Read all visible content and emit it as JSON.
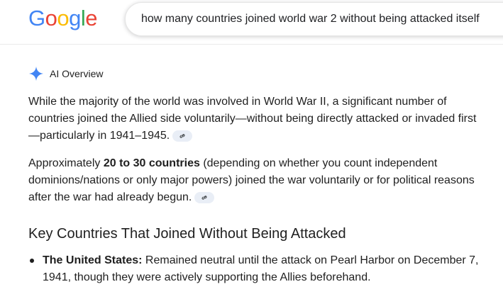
{
  "header": {
    "logo_text": "Google",
    "logo_letters": [
      {
        "ch": "G",
        "color": "#4285F4"
      },
      {
        "ch": "o",
        "color": "#EA4335"
      },
      {
        "ch": "o",
        "color": "#FBBC05"
      },
      {
        "ch": "g",
        "color": "#4285F4"
      },
      {
        "ch": "l",
        "color": "#34A853"
      },
      {
        "ch": "e",
        "color": "#EA4335"
      }
    ],
    "search_query": "how many countries joined world war 2 without being attacked itself"
  },
  "ai_overview": {
    "title": "AI Overview",
    "paragraph_1": "While the majority of the world was involved in World War II, a significant number of countries joined the Allied side voluntarily—without being directly attacked or invaded first—particularly in 1941–1945.",
    "paragraph_2_prefix": "Approximately ",
    "paragraph_2_bold": "20 to 30 countries",
    "paragraph_2_suffix": " (depending on whether you count independent dominions/nations or only major powers) joined the war voluntarily or for political reasons after the war had already begun.",
    "section_heading": "Key Countries That Joined Without Being Attacked",
    "bullets": [
      {
        "label": "The United States:",
        "text": " Remained neutral until the attack on Pearl Harbor on December 7, 1941, though they were actively supporting the Allies beforehand."
      }
    ]
  },
  "colors": {
    "spark_blue": "#4285F4",
    "chip_bg": "#e9eef6",
    "text": "#1f1f1f"
  },
  "icons": {
    "spark": "ai-sparkle-icon",
    "link": "link-icon"
  }
}
